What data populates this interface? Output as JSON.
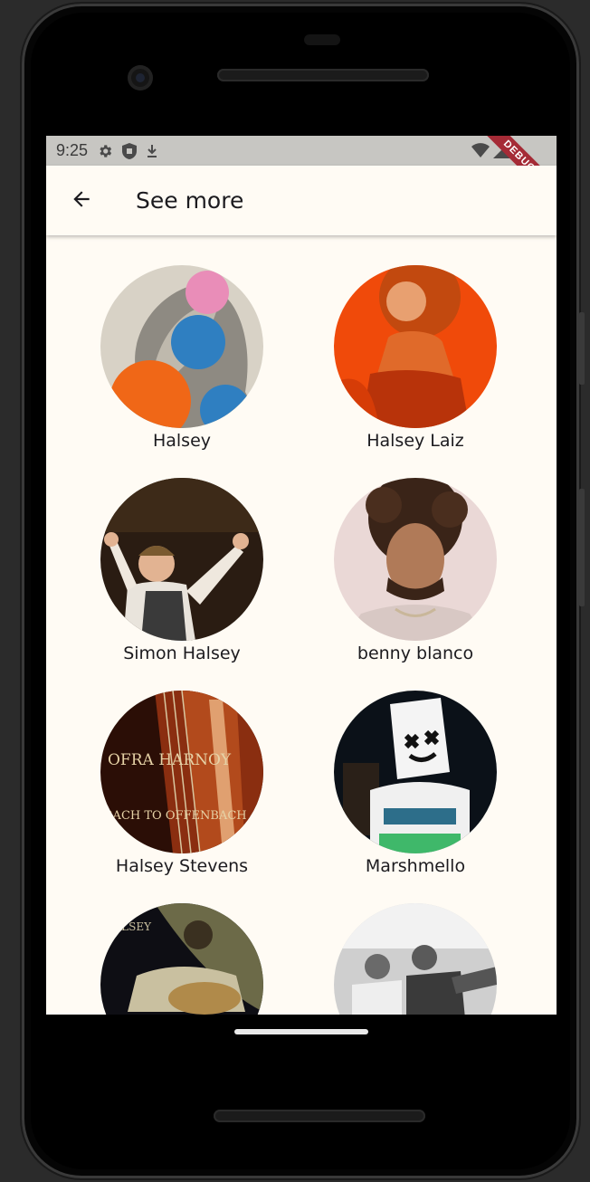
{
  "status_bar": {
    "time": "9:25",
    "debug_label": "DEBUG"
  },
  "app_bar": {
    "title": "See more",
    "back_icon": "arrow-back-icon"
  },
  "artists": [
    {
      "name": "Halsey"
    },
    {
      "name": "Halsey Laiz"
    },
    {
      "name": "Simon Halsey"
    },
    {
      "name": "benny blanco"
    },
    {
      "name": "Halsey Stevens"
    },
    {
      "name": "Marshmello"
    },
    {
      "name": ""
    },
    {
      "name": ""
    }
  ],
  "images": {
    "album_text_line1": "OFRA HARNOY",
    "album_text_line2": "BACH TO OFFENBACH",
    "album_text_small": "HALSEY"
  },
  "colors": {
    "background": "#fffbf4",
    "status_bar": "#c7c6c2",
    "debug_banner": "#a52b36",
    "text": "#1c1b1f"
  }
}
